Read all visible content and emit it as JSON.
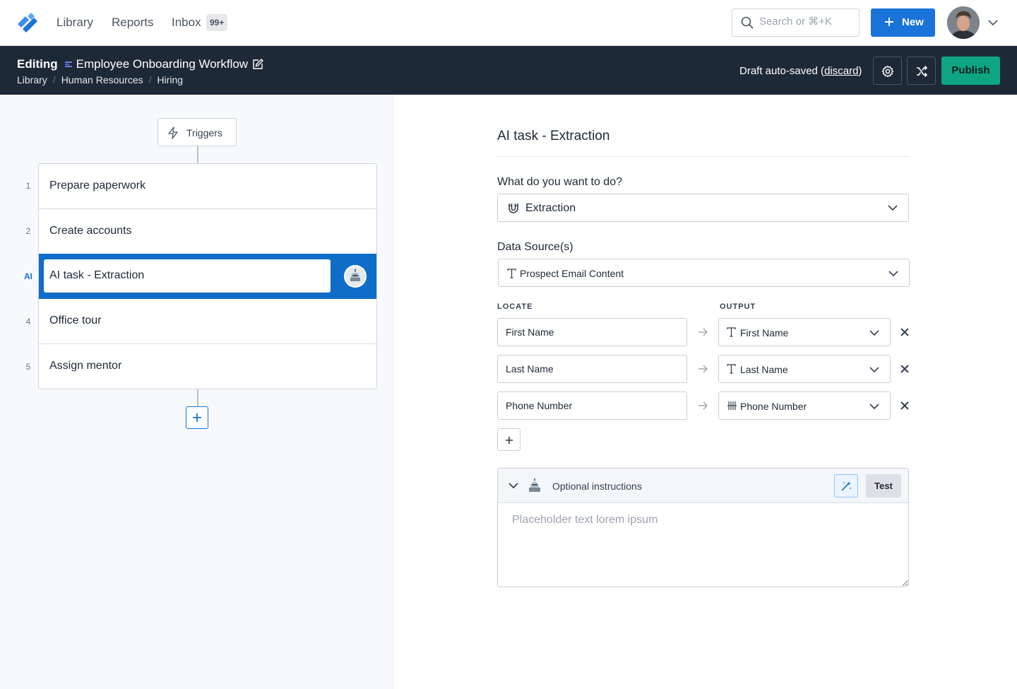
{
  "nav": {
    "links": [
      "Library",
      "Reports",
      "Inbox"
    ],
    "inbox_badge": "99+",
    "search_placeholder": "Search or ⌘+K",
    "new_label": "New"
  },
  "editbar": {
    "editing_label": "Editing",
    "workflow_name": "Employee Onboarding Workflow",
    "breadcrumbs": [
      "Library",
      "Human Resources",
      "Hiring"
    ],
    "draft_text": "Draft auto-saved (",
    "discard_label": "discard",
    "draft_close": ")",
    "publish_label": "Publish"
  },
  "workflow": {
    "triggers_label": "Triggers",
    "steps": [
      {
        "num": "1",
        "label": "Prepare paperwork"
      },
      {
        "num": "2",
        "label": "Create accounts"
      },
      {
        "num": "AI",
        "label": "AI task - Extraction",
        "active": true
      },
      {
        "num": "4",
        "label": "Office tour"
      },
      {
        "num": "5",
        "label": "Assign mentor"
      }
    ]
  },
  "task": {
    "title": "AI task - Extraction",
    "what_label": "What do you want to do?",
    "what_value": "Extraction",
    "source_label": "Data Source(s)",
    "source_value": "Prospect Email Content",
    "locate_header": "LOCATE",
    "output_header": "OUTPUT",
    "mappings": [
      {
        "locate": "First Name",
        "output": "First Name",
        "type": "text"
      },
      {
        "locate": "Last Name",
        "output": "Last Name",
        "type": "text"
      },
      {
        "locate": "Phone Number",
        "output": "Phone Number",
        "type": "number"
      }
    ],
    "instructions_label": "Optional instructions",
    "test_label": "Test",
    "instructions_placeholder": "Placeholder text lorem ipsum"
  },
  "colors": {
    "primary": "#1a73d9",
    "publish": "#0ea583",
    "editbar_bg": "#1e2937",
    "active_step": "#0f6cc9"
  }
}
